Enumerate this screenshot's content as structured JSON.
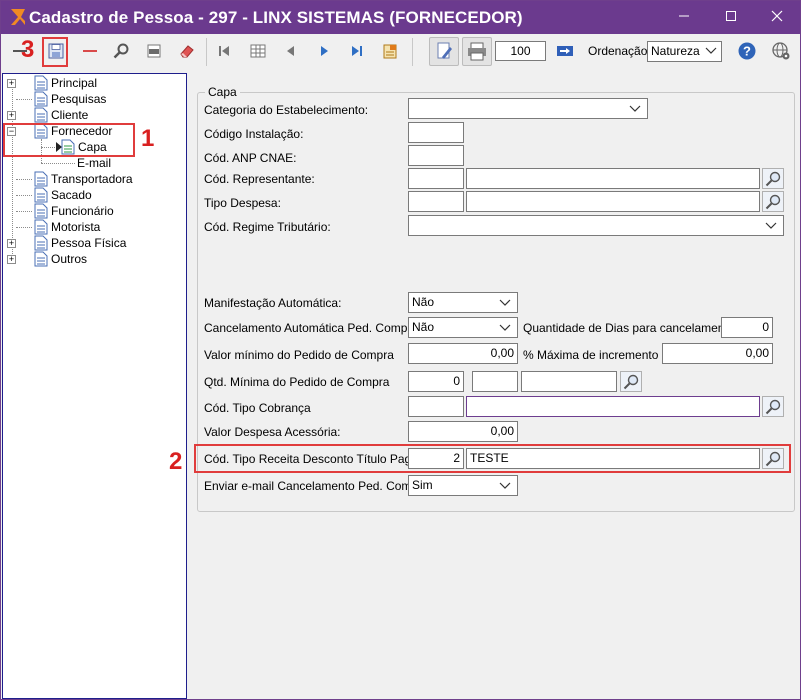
{
  "window": {
    "title": "Cadastro de Pessoa - 297 - LINX SISTEMAS (FORNECEDOR)"
  },
  "toolbar": {
    "zoom_value": "100",
    "ordenacao_label": "Ordenação:",
    "ordenacao_value": "Natureza"
  },
  "tree": {
    "items": [
      {
        "label": "Principal"
      },
      {
        "label": "Pesquisas"
      },
      {
        "label": "Cliente"
      },
      {
        "label": "Fornecedor"
      },
      {
        "label": "Capa"
      },
      {
        "label": "E-mail"
      },
      {
        "label": "Transportadora"
      },
      {
        "label": "Sacado"
      },
      {
        "label": "Funcionário"
      },
      {
        "label": "Motorista"
      },
      {
        "label": "Pessoa Física"
      },
      {
        "label": "Outros"
      }
    ]
  },
  "form": {
    "group_title": "Capa",
    "categoria_label": "Categoria do Estabelecimento:",
    "categoria_value": "",
    "codigo_instalacao_label": "Código Instalação:",
    "codigo_instalacao_value": "",
    "anp_label": "Cód. ANP CNAE:",
    "anp_value": "",
    "representante_label": "Cód. Representante:",
    "representante_code": "",
    "representante_desc": "",
    "tipo_despesa_label": "Tipo Despesa:",
    "tipo_despesa_code": "",
    "tipo_despesa_desc": "",
    "regime_label": "Cód. Regime Tributário:",
    "regime_value": "",
    "manifestacao_label": "Manifestação Automática:",
    "manifestacao_value": "Não",
    "cancelamento_label": "Cancelamento Automática Ped. Compra:",
    "cancelamento_value": "Não",
    "qtd_dias_label": "Quantidade de Dias para cancelamento:",
    "qtd_dias_value": "0",
    "valor_minimo_label": "Valor mínimo do Pedido de Compra",
    "valor_minimo_value": "0,00",
    "pct_maxima_label": "% Máxima de incremento",
    "pct_maxima_value": "0,00",
    "qtd_minima_label": "Qtd. Mínima do Pedido de Compra",
    "qtd_minima_value": "0",
    "qtd_minima_extra1": "",
    "qtd_minima_extra2": "",
    "tipo_cobranca_label": "Cód. Tipo Cobrança",
    "tipo_cobranca_code": "",
    "tipo_cobranca_desc": "",
    "despesa_acessoria_label": "Valor Despesa Acessória:",
    "despesa_acessoria_value": "0,00",
    "tipo_receita_label": "Cód. Tipo Receita Desconto Título Pagar:",
    "tipo_receita_code": "2",
    "tipo_receita_desc": "TESTE",
    "email_cancel_label": "Enviar e-mail Cancelamento Ped. Compra:",
    "email_cancel_value": "Sim"
  },
  "annotations": {
    "n1": "1",
    "n2": "2",
    "n3": "3"
  },
  "colors": {
    "titlebar": "#6b3a8e",
    "annotation_red": "#e03c3c"
  }
}
